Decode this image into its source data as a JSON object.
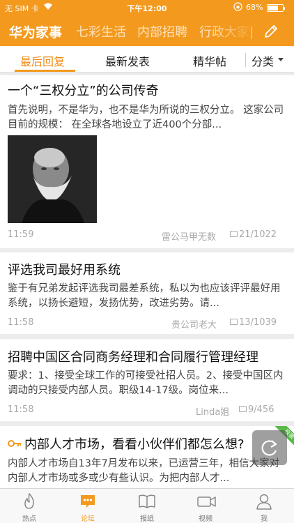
{
  "status_bar": {
    "carrier": "无 SIM 卡",
    "time": "下午12:00",
    "battery": "68%"
  },
  "channels": [
    "华为家事",
    "七彩生活",
    "内部招聘",
    "行政大家"
  ],
  "subtabs": [
    "最后回复",
    "最新发表",
    "精华帖",
    "分类"
  ],
  "posts": [
    {
      "title": "一个“三权分立”的公司传奇",
      "excerpt": "首先说明，不是华为，也不是华为所说的三权分立。 这家公司目前的规模： 在全球各地设立了近400个分部...",
      "time": "11:59",
      "author": "雷公马甲无数",
      "count": "21/1022"
    },
    {
      "title": "评选我司最好用系统",
      "excerpt": "鉴于有兄弟发起评选我司最差系统，私以为也应该评评最好用系统，以扬长避短，发扬优势，改进劣势。请...",
      "time": "11:58",
      "author": "贵公司老大",
      "count": "13/1039"
    },
    {
      "title": "招聘中国区合同商务经理和合同履行管理经理",
      "excerpt": "要求：1、接受全球工作的可接受社招人员。2、接受中国区内调动的只接受内部人员。职级14-17级。岗位来...",
      "time": "11:58",
      "author": "Linda姐",
      "count": "9/456"
    },
    {
      "title": "内部人才市场，看看小伙伴们都怎么想?",
      "excerpt": "内部人才市场自13年7月发布以来，已运营三年，相信大家对内部人才市场或多或少有些认识。为把内部人才...",
      "badge": "投票"
    }
  ],
  "tabbar": [
    "热点",
    "论坛",
    "报纸",
    "视频",
    "我"
  ],
  "colors": {
    "brand": "#f39a1e",
    "badge": "#58b848"
  }
}
